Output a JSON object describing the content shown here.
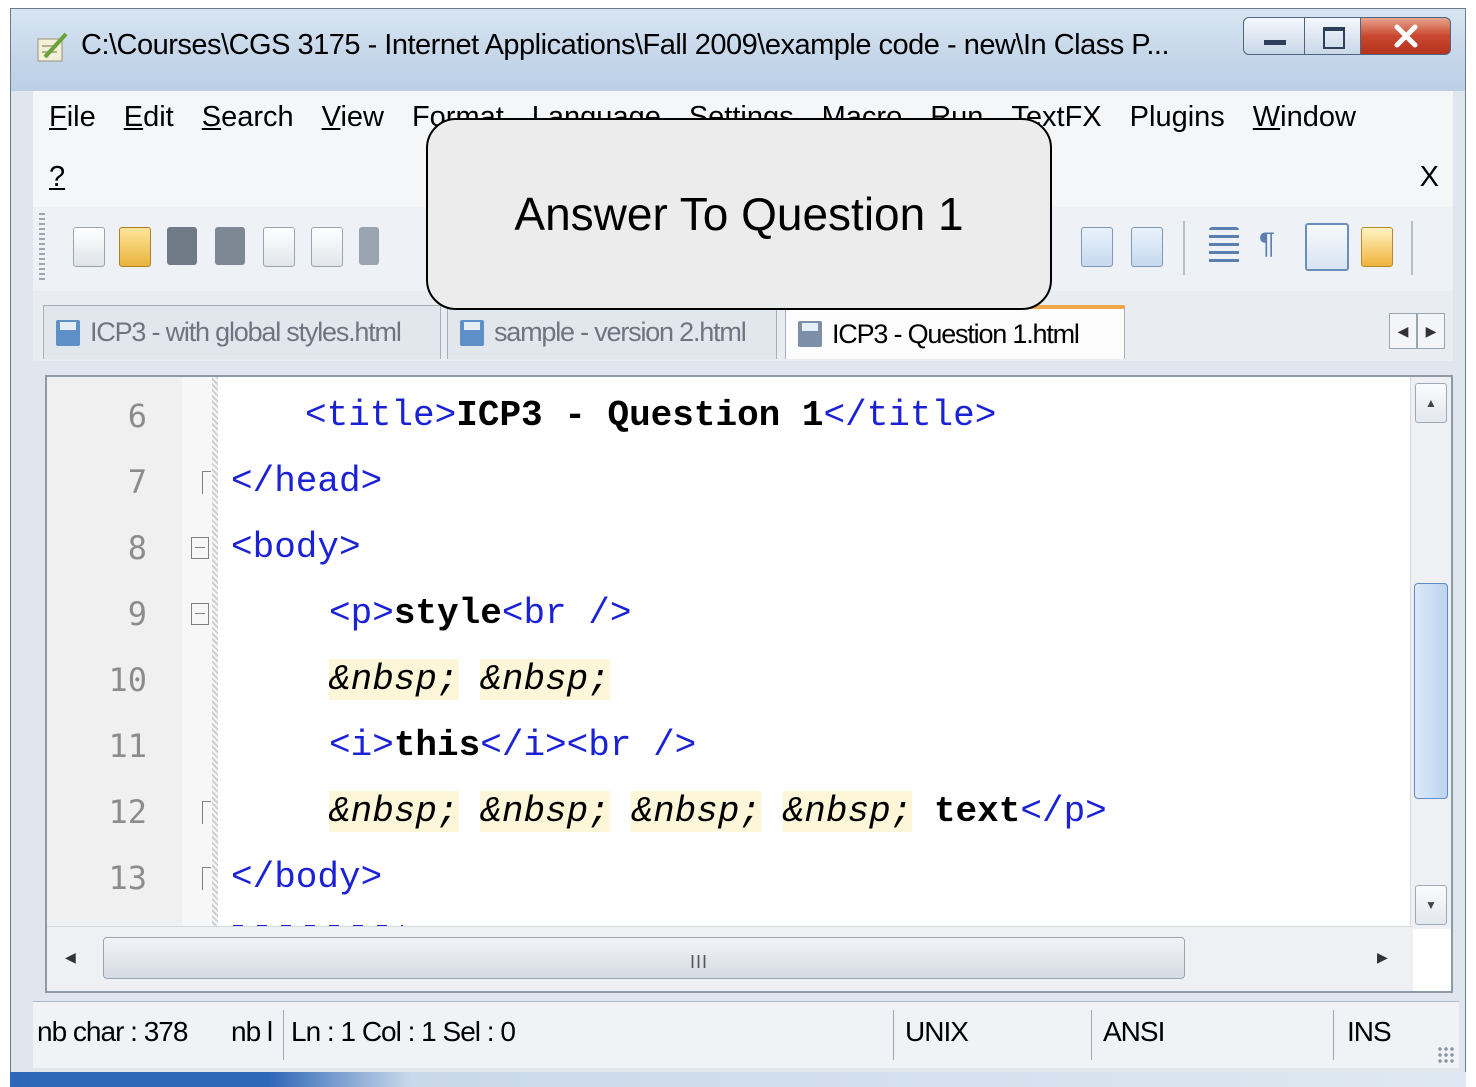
{
  "window": {
    "title": "C:\\Courses\\CGS 3175 - Internet Applications\\Fall 2009\\example code - new\\In Class P...",
    "icon": "notepad-plus-icon"
  },
  "menu": {
    "items": [
      {
        "underline": "F",
        "rest": "ile"
      },
      {
        "underline": "E",
        "rest": "dit"
      },
      {
        "underline": "S",
        "rest": "earch"
      },
      {
        "underline": "V",
        "rest": "iew"
      },
      {
        "underline": "",
        "rest": "Format"
      },
      {
        "underline": "",
        "rest": "Language"
      },
      {
        "underline": "",
        "rest": "Settings"
      },
      {
        "underline": "",
        "rest": "Macro"
      },
      {
        "underline": "",
        "rest": "Run"
      },
      {
        "underline": "",
        "rest": "TextFX"
      },
      {
        "underline": "",
        "rest": "Plugins"
      },
      {
        "underline": "W",
        "rest": "indow"
      }
    ],
    "help": "?",
    "close": "X"
  },
  "tabs": [
    {
      "label": "ICP3 - with global styles.html"
    },
    {
      "label": "sample - version 2.html"
    },
    {
      "label": "ICP3 - Question 1.html"
    }
  ],
  "editor": {
    "lines": [
      {
        "num": "6"
      },
      {
        "num": "7"
      },
      {
        "num": "8"
      },
      {
        "num": "9"
      },
      {
        "num": "10"
      },
      {
        "num": "11"
      },
      {
        "num": "12"
      },
      {
        "num": "13"
      }
    ],
    "code": {
      "l6_open": "<title>",
      "l6_text": "ICP3 - Question 1",
      "l6_close": "</title>",
      "l7": "</head>",
      "l8": "<body>",
      "l9_open": "<p>",
      "l9_text": "style",
      "l9_br": "<br />",
      "l10_e1": "&nbsp;",
      "l10_e2": "&nbsp;",
      "l11_open": "<i>",
      "l11_text": "this",
      "l11_close": "</i>",
      "l11_br": "<br />",
      "l12_e1": "&nbsp;",
      "l12_e2": "&nbsp;",
      "l12_e3": "&nbsp;",
      "l12_e4": "&nbsp;",
      "l12_text": "text",
      "l12_close": "</p>",
      "l13": "</body>"
    },
    "hscroll_grip": "III"
  },
  "status": {
    "chars": "nb char : 378",
    "lines": "nb l",
    "pos": "Ln : 1    Col : 1    Sel : 0",
    "eol": "UNIX",
    "encoding": "ANSI",
    "mode": "INS"
  },
  "callout": {
    "text": "Answer To Question 1"
  },
  "colors": {
    "tag": "#1b22d6",
    "entity_bg": "#fdf6d8",
    "active_tab_accent": "#f2a64a"
  }
}
